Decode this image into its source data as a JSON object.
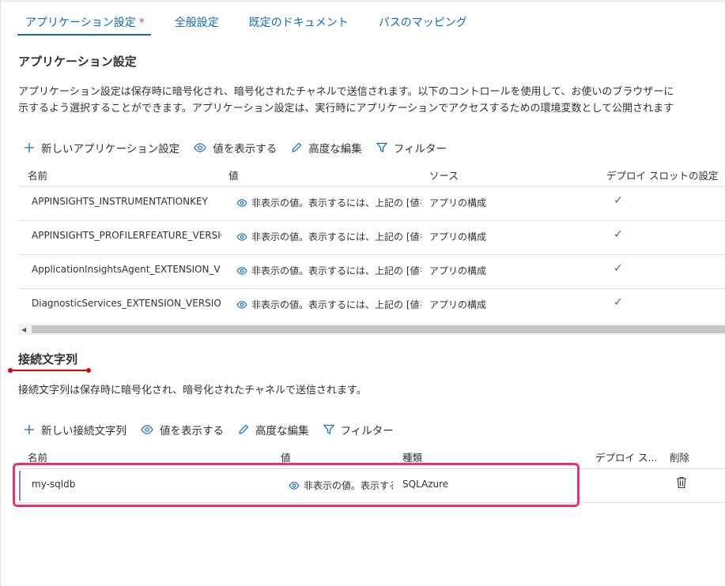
{
  "tabs": [
    {
      "label": "アプリケーション設定",
      "modified": "*"
    },
    {
      "label": "全般設定"
    },
    {
      "label": "既定のドキュメント"
    },
    {
      "label": "パスのマッピング"
    }
  ],
  "app_settings": {
    "title": "アプリケーション設定",
    "description_line1": "アプリケーション設定は保存時に暗号化され、暗号化されたチャネルで送信されます。以下のコントロールを使用して、お使いのブラウザーに",
    "description_line2": "示するよう選択することができます。アプリケーション設定は、実行時にアプリケーションでアクセスするための環境変数として公開されます",
    "toolbar": {
      "new": "新しいアプリケーション設定",
      "show_values": "値を表示する",
      "advanced_edit": "高度な編集",
      "filter": "フィルター"
    },
    "columns": {
      "name": "名前",
      "value": "値",
      "source": "ソース",
      "slot": "デプロイ スロットの設定"
    },
    "rows": [
      {
        "name": "APPINSIGHTS_INSTRUMENTATIONKEY",
        "value": "非表示の値。表示するには、上記の [値を表示する] をクリックします",
        "source": "アプリの構成",
        "slot": "✓"
      },
      {
        "name": "APPINSIGHTS_PROFILERFEATURE_VERSION",
        "value": "非表示の値。表示するには、上記の [値を表示する] をクリックします",
        "source": "アプリの構成",
        "slot": "✓"
      },
      {
        "name": "ApplicationInsightsAgent_EXTENSION_VERSION",
        "value": "非表示の値。表示するには、上記の [値を表示する] をクリックします",
        "source": "アプリの構成",
        "slot": "✓"
      },
      {
        "name": "DiagnosticServices_EXTENSION_VERSION",
        "value": "非表示の値。表示するには、上記の [値を表示する] をクリックします",
        "source": "アプリの構成",
        "slot": "✓"
      }
    ]
  },
  "connection_strings": {
    "title": "接続文字列",
    "description": "接続文字列は保存時に暗号化され、暗号化されたチャネルで送信されます。",
    "toolbar": {
      "new": "新しい接続文字列",
      "show_values": "値を表示する",
      "advanced_edit": "高度な編集",
      "filter": "フィルター"
    },
    "columns": {
      "name": "名前",
      "value": "値",
      "type": "種類",
      "slot": "デプロイ ス...",
      "delete": "削除"
    },
    "rows": [
      {
        "name": "my-sqldb",
        "value": "非表示の値。表示するには、上記の [値を表示する] をクリックします",
        "type": "SQLAzure"
      }
    ]
  },
  "colors": {
    "accent": "#0f6cbd",
    "highlight": "#e8336c",
    "annotation": "#e3000b",
    "modified_star": "#c239b3"
  }
}
